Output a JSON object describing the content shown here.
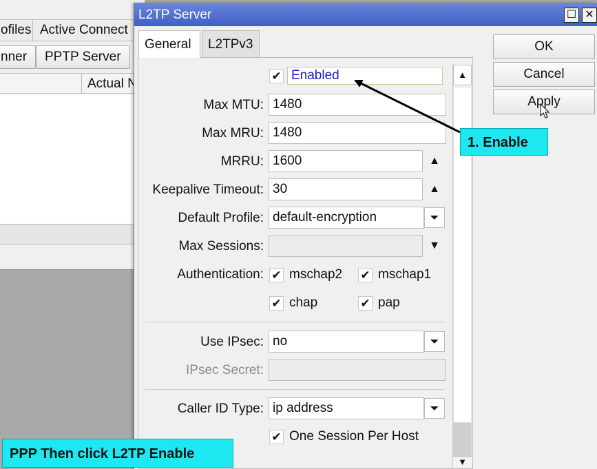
{
  "background_window": {
    "tabs": [
      "ofiles",
      "Active Connect"
    ],
    "buttons": [
      "nner",
      "PPTP Server"
    ],
    "column_header": "Actual N"
  },
  "dialog": {
    "title": "L2TP Server",
    "title_buttons": {
      "maximize": "☐",
      "close": "✕"
    },
    "tabs": [
      "General",
      "L2TPv3"
    ],
    "enabled": {
      "label": "Enabled",
      "checked": true
    },
    "fields": {
      "max_mtu": {
        "label": "Max MTU:",
        "value": "1480"
      },
      "max_mru": {
        "label": "Max MRU:",
        "value": "1480"
      },
      "mrru": {
        "label": "MRRU:",
        "value": "1600"
      },
      "keepalive": {
        "label": "Keepalive Timeout:",
        "value": "30"
      },
      "default_profile": {
        "label": "Default Profile:",
        "value": "default-encryption"
      },
      "max_sessions": {
        "label": "Max Sessions:",
        "value": ""
      },
      "authentication": {
        "label": "Authentication:"
      },
      "use_ipsec": {
        "label": "Use IPsec:",
        "value": "no"
      },
      "ipsec_secret": {
        "label": "IPsec Secret:",
        "value": ""
      },
      "caller_id_type": {
        "label": "Caller ID Type:",
        "value": "ip address"
      }
    },
    "auth_options": [
      {
        "label": "mschap2",
        "checked": true
      },
      {
        "label": "mschap1",
        "checked": true
      },
      {
        "label": "chap",
        "checked": true
      },
      {
        "label": "pap",
        "checked": true
      }
    ],
    "one_session_per_host": {
      "label": "One Session Per Host",
      "checked": true
    },
    "buttons": {
      "ok": "OK",
      "cancel": "Cancel",
      "apply": "Apply"
    },
    "glyphs": {
      "check": "✔",
      "up": "▲",
      "down": "▼",
      "dropdown": "⏷"
    }
  },
  "annotations": {
    "enable_callout": "1. Enable",
    "ppp_callout": "PPP Then click L2TP Enable"
  },
  "colors": {
    "titlebar": "#4a67cf",
    "callout": "#1ee7f2",
    "enabled_text": "#1a1ac8"
  }
}
